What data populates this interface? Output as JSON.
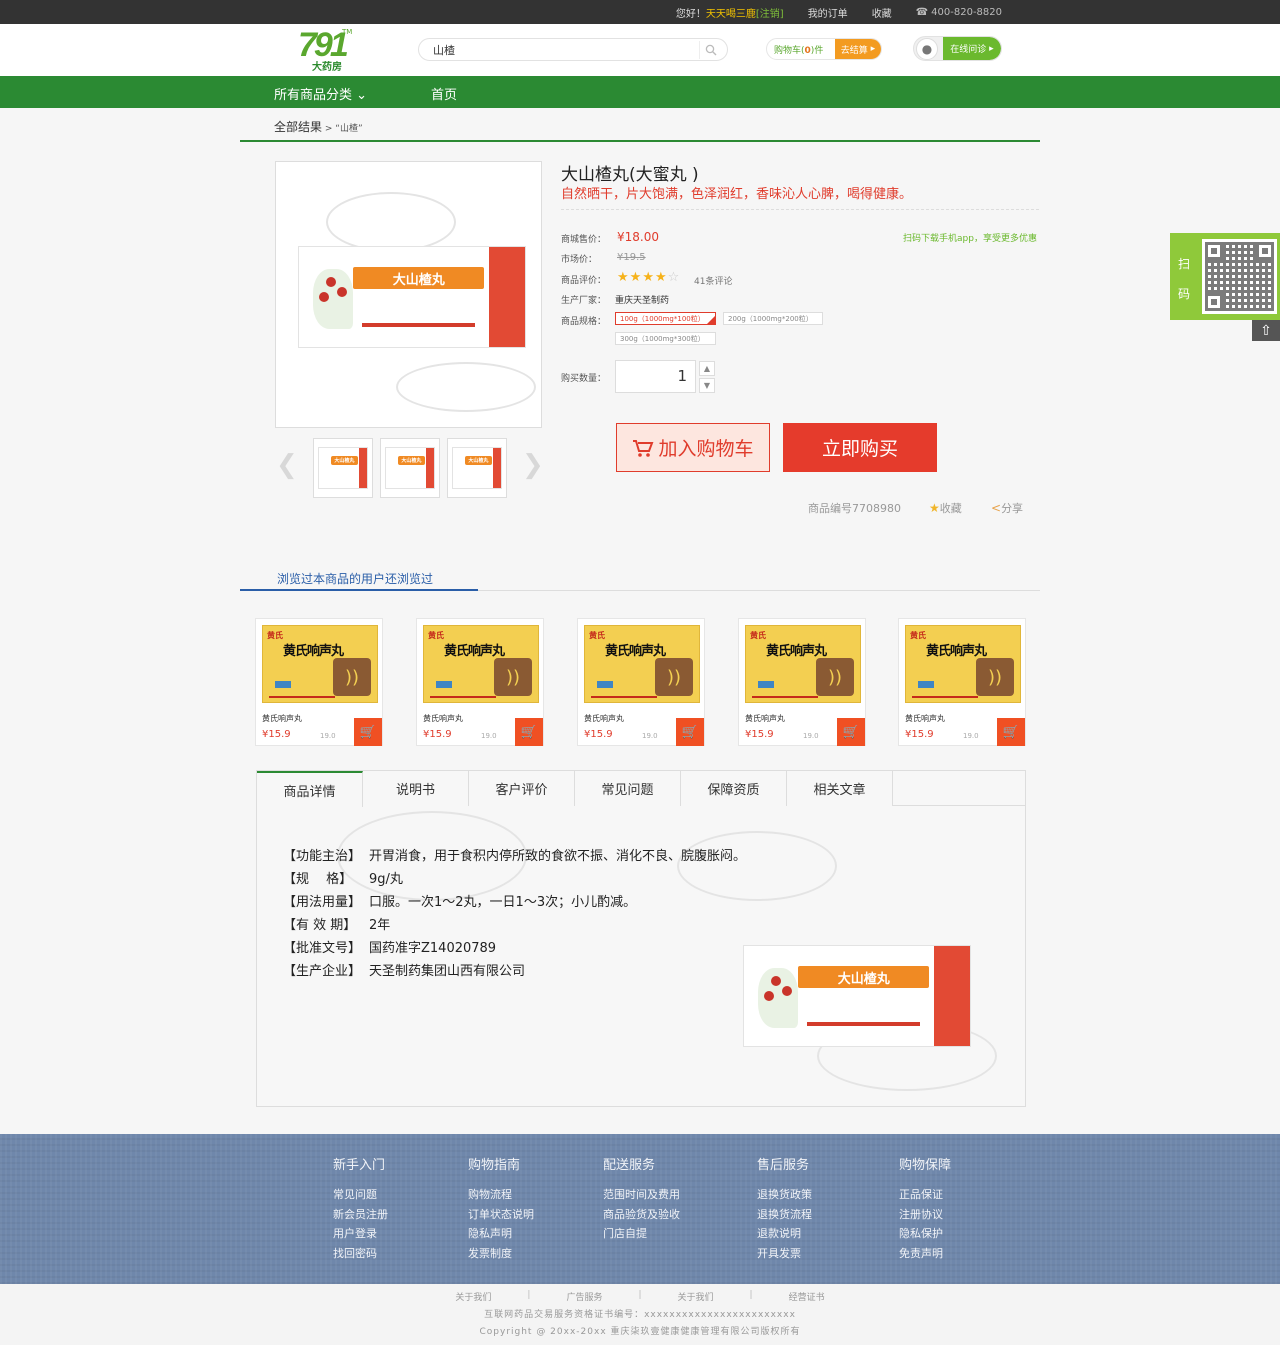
{
  "topbar": {
    "greeting": "您好！",
    "username": "天天喝三鹿",
    "logout": "[注销]",
    "orders": "我的订单",
    "favorites": "收藏",
    "phone": "400-820-8820"
  },
  "header": {
    "logo_num": "791",
    "logo_tm": "TM",
    "logo_text": "大药房",
    "search_value": "山楂",
    "cart_label": "购物车",
    "cart_count": "0",
    "cart_unit": "件",
    "checkout": "去结算",
    "consult": "在线问诊"
  },
  "nav": {
    "all_categories": "所有商品分类",
    "home": "首页"
  },
  "breadcrumb": {
    "root": "全部结果",
    "term": "“山楂”"
  },
  "product": {
    "box_name": "大山楂丸",
    "title": "大山楂丸(大蜜丸 )",
    "slogan": "自然晒干，片大饱满，色泽润红，香味沁人心脾，喝得健康。",
    "price_label": "商城售价：",
    "price": "¥18.00",
    "market_label": "市场价：",
    "market_price": "¥19.5",
    "app_tip": "扫码下载手机app，享受更多优惠",
    "rating_label": "商品评价：",
    "rating": 4,
    "reviews": "41条评论",
    "maker_label": "生产厂家：",
    "maker": "重庆天圣制药",
    "spec_label": "商品规格：",
    "specs": [
      "100g（1000mg*100粒）",
      "200g（1000mg*200粒）",
      "300g（1000mg*300粒）"
    ],
    "qty_label": "购买数量：",
    "qty": "1",
    "add_cart": "加入购物车",
    "buy_now": "立即购买",
    "sku": "商品编号7708980",
    "fav": "收藏",
    "share": "分享"
  },
  "side": {
    "qr_label": "扫码"
  },
  "also_viewed": {
    "title": "浏览过本商品的用户还浏览过",
    "items": [
      {
        "brand": "黄氏",
        "box": "黄氏响声丸",
        "name": "黄氏响声丸",
        "price": "¥15.9",
        "old": "19.0"
      },
      {
        "brand": "黄氏",
        "box": "黄氏响声丸",
        "name": "黄氏响声丸",
        "price": "¥15.9",
        "old": "19.0"
      },
      {
        "brand": "黄氏",
        "box": "黄氏响声丸",
        "name": "黄氏响声丸",
        "price": "¥15.9",
        "old": "19.0"
      },
      {
        "brand": "黄氏",
        "box": "黄氏响声丸",
        "name": "黄氏响声丸",
        "price": "¥15.9",
        "old": "19.0"
      },
      {
        "brand": "黄氏",
        "box": "黄氏响声丸",
        "name": "黄氏响声丸",
        "price": "¥15.9",
        "old": "19.0"
      }
    ]
  },
  "tabs": [
    "商品详情",
    "说明书",
    "客户评价",
    "常见问题",
    "保障资质",
    "相关文章"
  ],
  "details": [
    {
      "k": "【功能主治】",
      "v": "开胃消食，用于食积内停所致的食欲不振、消化不良、脘腹胀闷。"
    },
    {
      "k": "【规　 格】",
      "v": "9g/丸"
    },
    {
      "k": "【用法用量】",
      "v": "口服。一次1～2丸，一日1～3次；小儿酌减。"
    },
    {
      "k": "【有 效 期】",
      "v": "2年"
    },
    {
      "k": "【批准文号】",
      "v": "国药准字Z14020789"
    },
    {
      "k": "【生产企业】",
      "v": "天圣制药集团山西有限公司"
    }
  ],
  "footer": {
    "cols": [
      {
        "h": "新手入门",
        "items": [
          "常见问题",
          "新会员注册",
          "用户登录",
          "找回密码"
        ]
      },
      {
        "h": "购物指南",
        "items": [
          "购物流程",
          "订单状态说明",
          "隐私声明",
          "发票制度"
        ]
      },
      {
        "h": "配送服务",
        "items": [
          "范围时间及费用",
          "商品验货及验收",
          "门店自提"
        ]
      },
      {
        "h": "售后服务",
        "items": [
          "退换货政策",
          "退换货流程",
          "退款说明",
          "开具发票"
        ]
      },
      {
        "h": "购物保障",
        "items": [
          "正品保证",
          "注册协议",
          "隐私保护",
          "免责声明"
        ]
      }
    ],
    "links": [
      "关于我们",
      "广告服务",
      "关于我们",
      "经营证书"
    ],
    "license": "互联网药品交易服务资格证书编号：xxxxxxxxxxxxxxxxxxxxxxxx",
    "copyright": "Copyright @ 20xx-20xx 重庆柒玖壹健康健康管理有限公司版权所有"
  }
}
